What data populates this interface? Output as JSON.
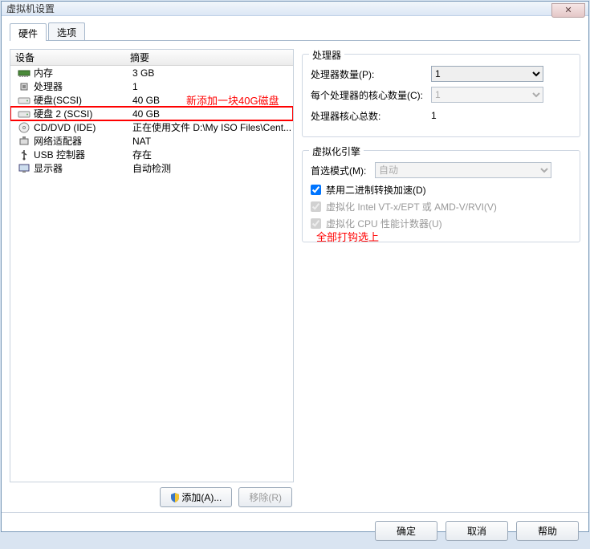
{
  "window": {
    "title": "虚拟机设置"
  },
  "tabs": {
    "hardware": "硬件",
    "options": "选项"
  },
  "deviceList": {
    "colDevice": "设备",
    "colSummary": "摘要",
    "rows": [
      {
        "icon": "memory-icon",
        "name": "内存",
        "summary": "3 GB",
        "highlight": false
      },
      {
        "icon": "cpu-icon",
        "name": "处理器",
        "summary": "1",
        "highlight": false
      },
      {
        "icon": "hdd-icon",
        "name": "硬盘(SCSI)",
        "summary": "40 GB",
        "highlight": false
      },
      {
        "icon": "hdd-icon",
        "name": "硬盘 2 (SCSI)",
        "summary": "40 GB",
        "highlight": true
      },
      {
        "icon": "cd-icon",
        "name": "CD/DVD (IDE)",
        "summary": "正在使用文件 D:\\My ISO Files\\Cent...",
        "highlight": false
      },
      {
        "icon": "net-icon",
        "name": "网络适配器",
        "summary": "NAT",
        "highlight": false
      },
      {
        "icon": "usb-icon",
        "name": "USB 控制器",
        "summary": "存在",
        "highlight": false
      },
      {
        "icon": "display-icon",
        "name": "显示器",
        "summary": "自动检测",
        "highlight": false
      }
    ]
  },
  "buttons": {
    "add": "添加(A)...",
    "remove": "移除(R)"
  },
  "processorGroup": {
    "title": "处理器",
    "countLabel": "处理器数量(P):",
    "countValue": "1",
    "coresLabel": "每个处理器的核心数量(C):",
    "coresValue": "1",
    "totalLabel": "处理器核心总数:",
    "totalValue": "1"
  },
  "virtGroup": {
    "title": "虚拟化引擎",
    "modeLabel": "首选模式(M):",
    "modeValue": "自动",
    "chk1": "禁用二进制转换加速(D)",
    "chk2": "虚拟化 Intel VT-x/EPT 或 AMD-V/RVI(V)",
    "chk3": "虚拟化 CPU 性能计数器(U)"
  },
  "annotations": {
    "addDisk": "新添加一块40G磁盘",
    "checkAll": "全部打钩选上"
  },
  "bottom": {
    "ok": "确定",
    "cancel": "取消",
    "help": "帮助"
  }
}
